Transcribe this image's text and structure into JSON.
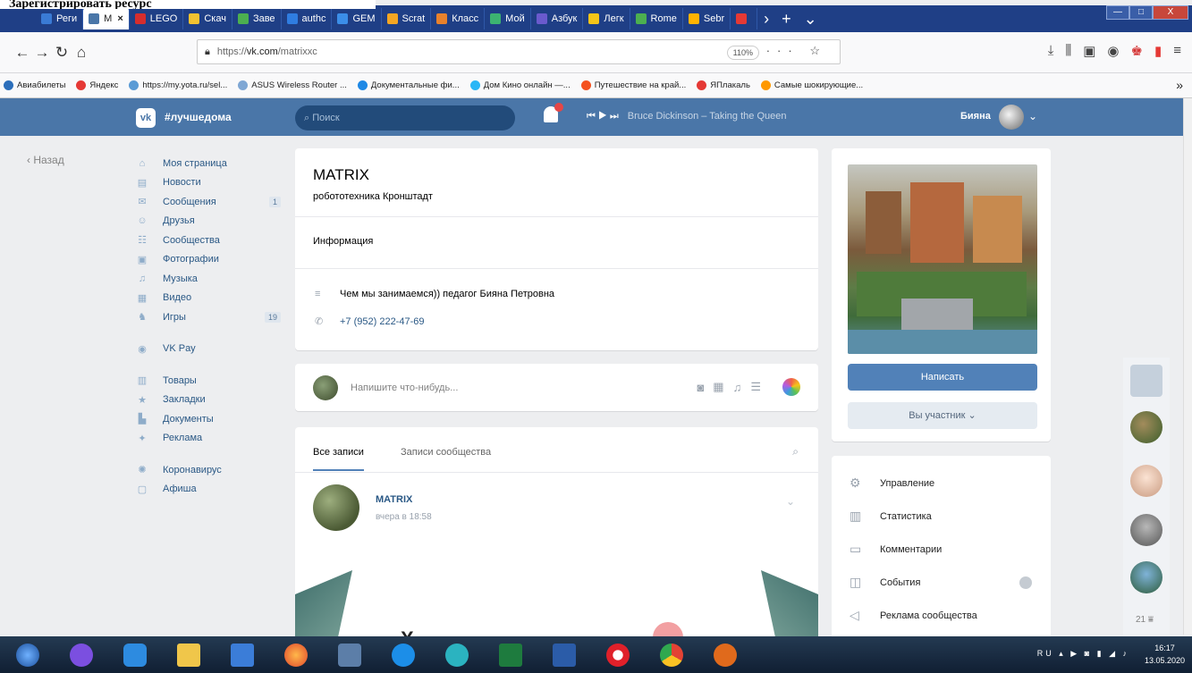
{
  "caption": "Зарегистрировать ресурс",
  "window": {
    "controls": [
      "—",
      "□",
      "X"
    ]
  },
  "tabs": [
    {
      "label": "Реги",
      "color": "#3a7bd5"
    },
    {
      "label": "М",
      "color": "#4a76a8",
      "active": true
    },
    {
      "label": "LEGO",
      "color": "#d62d2d"
    },
    {
      "label": "Скач",
      "color": "#f2c230"
    },
    {
      "label": "Заве",
      "color": "#4caf50"
    },
    {
      "label": "authc",
      "color": "#2f7de1"
    },
    {
      "label": "GEM",
      "color": "#3b8ee8"
    },
    {
      "label": "Scrat",
      "color": "#f4a623"
    },
    {
      "label": "Класс",
      "color": "#e8812c"
    },
    {
      "label": "Мой",
      "color": "#3cb371"
    },
    {
      "label": "Азбук",
      "color": "#6a5acd"
    },
    {
      "label": "Легк",
      "color": "#f5c518"
    },
    {
      "label": "Rome",
      "color": "#4caf50"
    },
    {
      "label": "Sebr",
      "color": "#ffb300"
    },
    {
      "label": "",
      "color": "#e53935"
    }
  ],
  "nav": {
    "url_prefix": "https://",
    "url_domain": "vk.com",
    "url_path": "/matrixxc",
    "zoom": "110%",
    "more": "···"
  },
  "bookmarks": [
    {
      "label": "Авиабилеты",
      "color": "#2c6fbb"
    },
    {
      "label": "Яндекс",
      "color": "#e53935"
    },
    {
      "label": "https://my.yota.ru/sel...",
      "color": "#5b9bd5"
    },
    {
      "label": "ASUS Wireless Router ...",
      "color": "#7fa7d4"
    },
    {
      "label": "Документальные фи...",
      "color": "#1e88e5"
    },
    {
      "label": "Дом Кино онлайн —...",
      "color": "#29b6f6"
    },
    {
      "label": "Путешествие на край...",
      "color": "#f4511e"
    },
    {
      "label": "ЯПлакаль",
      "color": "#e53935"
    },
    {
      "label": "Самые шокирующие...",
      "color": "#ff9800"
    }
  ],
  "bookmarks_more": "»",
  "vk": {
    "logo": "vk",
    "group_tag": "#лучшедома",
    "search_placeholder": "Поиск",
    "player_controls": "⏮  ▶  ⏭",
    "track": "Bruce Dickinson – Taking the Queen",
    "user": "Бияна"
  },
  "back_label": "Назад",
  "left_menu": [
    {
      "icon": "⌂",
      "label": "Моя страница"
    },
    {
      "icon": "▤",
      "label": "Новости"
    },
    {
      "icon": "✉",
      "label": "Сообщения",
      "count": "1"
    },
    {
      "icon": "☺",
      "label": "Друзья"
    },
    {
      "icon": "☷",
      "label": "Сообщества"
    },
    {
      "icon": "▣",
      "label": "Фотографии"
    },
    {
      "icon": "♫",
      "label": "Музыка"
    },
    {
      "icon": "▦",
      "label": "Видео"
    },
    {
      "icon": "♞",
      "label": "Игры",
      "count": "19"
    },
    {
      "sep": true
    },
    {
      "icon": "◉",
      "label": "VK Pay"
    },
    {
      "sep": true
    },
    {
      "icon": "▥",
      "label": "Товары"
    },
    {
      "icon": "★",
      "label": "Закладки"
    },
    {
      "icon": "▙",
      "label": "Документы"
    },
    {
      "icon": "✦",
      "label": "Реклама"
    },
    {
      "sep": true
    },
    {
      "icon": "✺",
      "label": "Коронавирус"
    },
    {
      "icon": "▢",
      "label": "Афиша"
    }
  ],
  "profile": {
    "name": "MATRIX",
    "status": "робототехника Кронштадт",
    "info_label": "Информация",
    "description": "Чем мы занимаемся)) педагог Бияна Петровна",
    "phone": "+7 (952) 222-47-69"
  },
  "post_box": {
    "placeholder": "Напишите что-нибудь..."
  },
  "feed": {
    "tab_all": "Все записи",
    "tab_community": "Записи сообщества",
    "author": "MATRIX",
    "date": "вчера в 18:58",
    "big_letter": "Х"
  },
  "side": {
    "message_button": "Написать",
    "member_button": "Вы участник ⌄"
  },
  "management": [
    {
      "icon": "⚙",
      "label": "Управление"
    },
    {
      "icon": "▥",
      "label": "Статистика"
    },
    {
      "icon": "▭",
      "label": "Комментарии"
    },
    {
      "icon": "◫",
      "label": "События",
      "dot": true
    },
    {
      "icon": "◁",
      "label": "Реклама сообщества"
    }
  ],
  "chats_count": "21 ⩸",
  "tray": {
    "lang": "RU",
    "time": "16:17",
    "date": "13.05.2020"
  }
}
